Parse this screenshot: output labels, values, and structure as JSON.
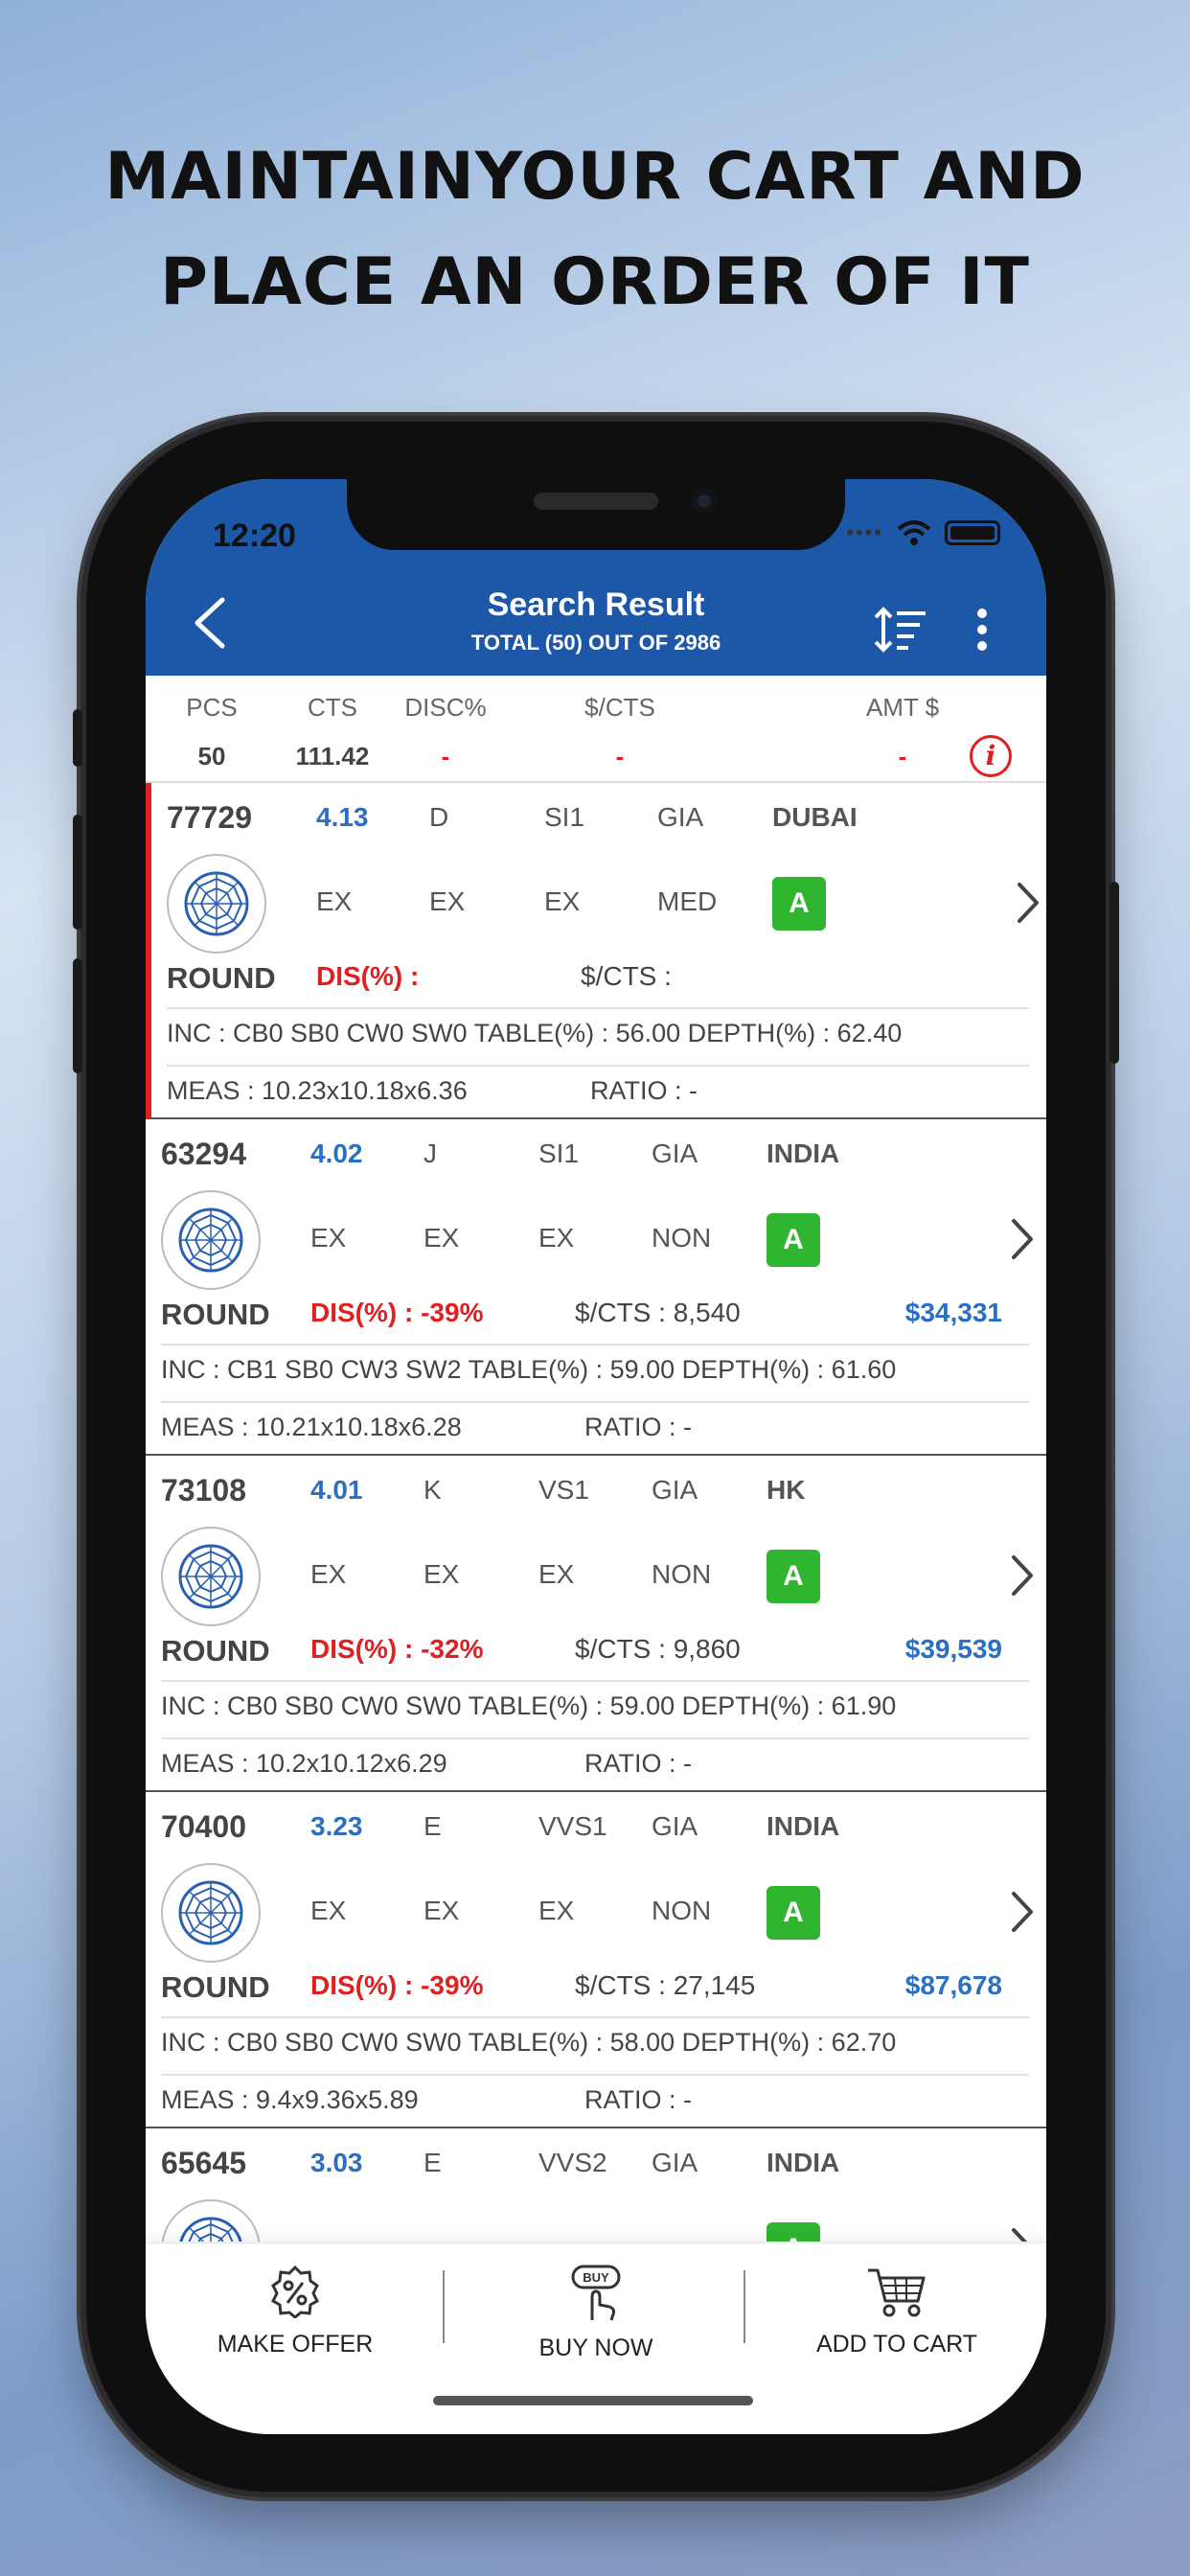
{
  "headline": {
    "line1": "MAINTAINYOUR CART AND",
    "line2": "PLACE AN ORDER OF IT"
  },
  "status": {
    "time": "12:20",
    "dots": "••••"
  },
  "appbar": {
    "title": "Search Result",
    "subtitle": "TOTAL (50) OUT OF 2986"
  },
  "summary": {
    "headers": [
      "PCS",
      "CTS",
      "DISC%",
      "$/CTS",
      "AMT $"
    ],
    "values": [
      "50",
      "111.42",
      "-",
      "-",
      "-"
    ],
    "info_glyph": "i"
  },
  "cards": [
    {
      "id": "77729",
      "cts": "4.13",
      "color": "D",
      "clarity": "SI1",
      "lab": "GIA",
      "location": "DUBAI",
      "cut": "EX",
      "polish": "EX",
      "symmetry": "EX",
      "fluor": "MED",
      "badge": "A",
      "shape": "ROUND",
      "disc": "DIS(%) :",
      "price_per_ct": "$/CTS :",
      "amount": "",
      "inc": "INC : CB0 SB0 CW0 SW0   TABLE(%) : 56.00  DEPTH(%) : 62.40",
      "meas": "MEAS : 10.23x10.18x6.36",
      "ratio": "RATIO : -"
    },
    {
      "id": "63294",
      "cts": "4.02",
      "color": "J",
      "clarity": "SI1",
      "lab": "GIA",
      "location": "INDIA",
      "cut": "EX",
      "polish": "EX",
      "symmetry": "EX",
      "fluor": "NON",
      "badge": "A",
      "shape": "ROUND",
      "disc": "DIS(%) : -39%",
      "price_per_ct": "$/CTS : 8,540",
      "amount": "$34,331",
      "inc": "INC : CB1 SB0 CW3 SW2  TABLE(%) : 59.00  DEPTH(%) : 61.60",
      "meas": "MEAS : 10.21x10.18x6.28",
      "ratio": "RATIO : -"
    },
    {
      "id": "73108",
      "cts": "4.01",
      "color": "K",
      "clarity": "VS1",
      "lab": "GIA",
      "location": "HK",
      "cut": "EX",
      "polish": "EX",
      "symmetry": "EX",
      "fluor": "NON",
      "badge": "A",
      "shape": "ROUND",
      "disc": "DIS(%) : -32%",
      "price_per_ct": "$/CTS : 9,860",
      "amount": "$39,539",
      "inc": "INC : CB0 SB0 CW0 SW0   TABLE(%) : 59.00  DEPTH(%) : 61.90",
      "meas": "MEAS : 10.2x10.12x6.29",
      "ratio": "RATIO : -"
    },
    {
      "id": "70400",
      "cts": "3.23",
      "color": "E",
      "clarity": "VVS1",
      "lab": "GIA",
      "location": "INDIA",
      "cut": "EX",
      "polish": "EX",
      "symmetry": "EX",
      "fluor": "NON",
      "badge": "A",
      "shape": "ROUND",
      "disc": "DIS(%) : -39%",
      "price_per_ct": "$/CTS : 27,145",
      "amount": "$87,678",
      "inc": "INC : CB0 SB0 CW0 SW0   TABLE(%) : 58.00  DEPTH(%) : 62.70",
      "meas": "MEAS : 9.4x9.36x5.89",
      "ratio": "RATIO : -"
    },
    {
      "id": "65645",
      "cts": "3.03",
      "color": "E",
      "clarity": "VVS2",
      "lab": "GIA",
      "location": "INDIA",
      "cut": "",
      "polish": "",
      "symmetry": "",
      "fluor": "",
      "badge": "A",
      "shape": "",
      "disc": "",
      "price_per_ct": "",
      "amount": "",
      "inc": "",
      "meas": "",
      "ratio": ""
    }
  ],
  "bottom_actions": {
    "make_offer": "MAKE OFFER",
    "buy_now": "BUY NOW",
    "buy_badge": "BUY",
    "add_to_cart": "ADD TO CART"
  },
  "colors": {
    "primary": "#1d57a8",
    "accent_red": "#e02020",
    "badge_green": "#2fb52f",
    "value_blue": "#2a6fc2"
  },
  "icons": [
    "back-arrow-icon",
    "sort-icon",
    "more-vertical-icon",
    "info-icon",
    "diamond-icon",
    "chevron-right-icon",
    "percent-tag-icon",
    "buy-hand-icon",
    "cart-icon",
    "wifi-icon",
    "battery-icon"
  ]
}
